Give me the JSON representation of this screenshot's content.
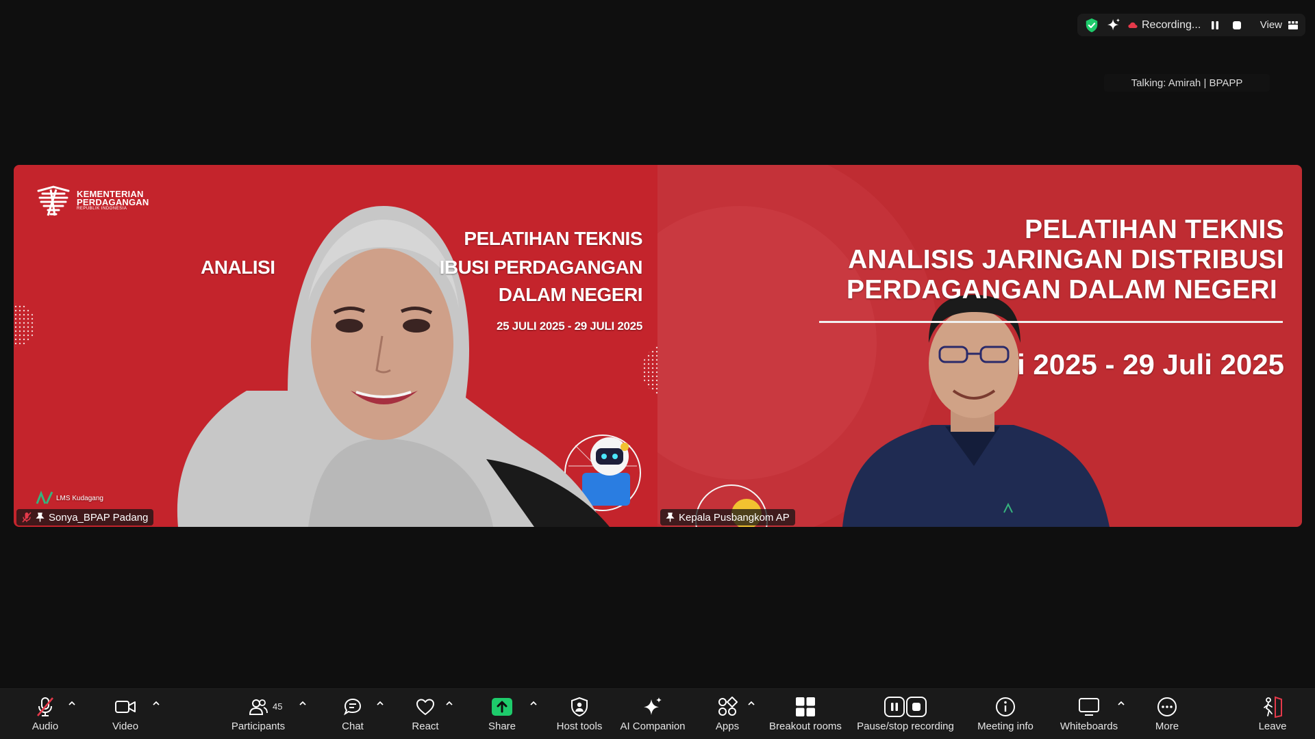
{
  "status_bar": {
    "recording_label": "Recording...",
    "view_label": "View",
    "talking_label": "Talking: Amirah | BPAPP"
  },
  "participants_tiles": [
    {
      "name": "Sonya_BPAP Padang",
      "slide": {
        "logo_name_1": "KEMENTERIAN",
        "logo_name_2": "PERDAGANGAN",
        "logo_sub": "REPUBLIK INDONESIA",
        "title_1": "PELATIHAN TEKNIS",
        "title_2_left": "ANALISI",
        "title_2_right": "IBUSI PERDAGANGAN",
        "title_3": "DALAM NEGERI",
        "date": "25 JULI 2025 - 29 JULI 2025",
        "corner_text": "LMS Kudagang"
      }
    },
    {
      "name": "Kepala Pusbangkom AP",
      "slide": {
        "title_1": "PELATIHAN TEKNIS",
        "title_2": "ANALISIS JARINGAN DISTRIBUSI",
        "title_3": "PERDAGANGAN DALAM NEGERI",
        "date": "i 2025 - 29 Juli 2025"
      }
    }
  ],
  "toolbar": {
    "audio": "Audio",
    "video": "Video",
    "participants": "Participants",
    "participants_count": "45",
    "chat": "Chat",
    "react": "React",
    "share": "Share",
    "host_tools": "Host tools",
    "ai_companion": "AI Companion",
    "apps": "Apps",
    "breakout_rooms": "Breakout rooms",
    "pause_stop_recording": "Pause/stop recording",
    "meeting_info": "Meeting info",
    "whiteboards": "Whiteboards",
    "more": "More",
    "leave": "Leave"
  },
  "colors": {
    "slide_red": "#c4242c",
    "share_green": "#1ecb6b",
    "shield_green": "#1ecb6b",
    "leave_red": "#e5394a"
  }
}
